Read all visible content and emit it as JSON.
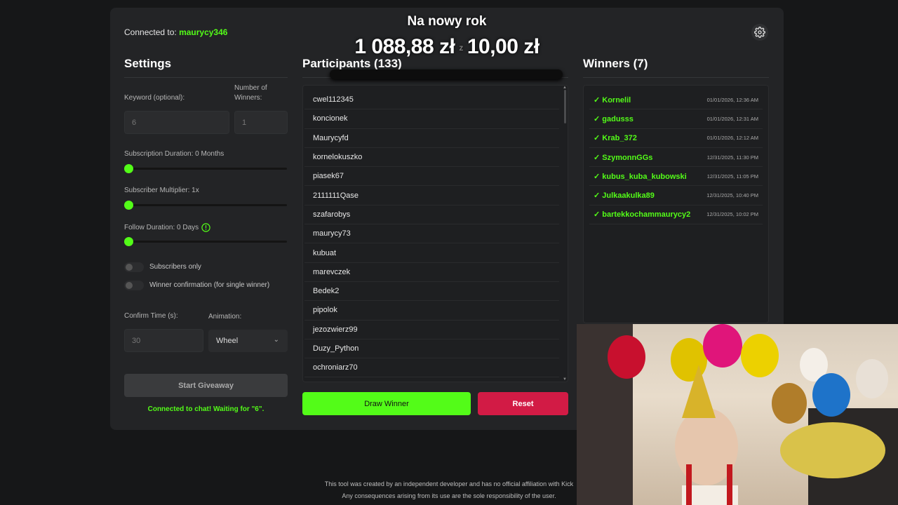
{
  "header": {
    "connected_label": "Connected to:",
    "channel": "maurycy346"
  },
  "overlay": {
    "title": "Na nowy rok",
    "current_amount": "1 088,88 zł",
    "separator": "z",
    "goal_amount": "10,00 zł"
  },
  "settings": {
    "title": "Settings",
    "keyword_label": "Keyword (optional):",
    "keyword_value": "6",
    "winners_label": "Number of Winners:",
    "winners_value": "1",
    "sub_duration_label": "Subscription Duration: 0 Months",
    "sub_multiplier_label": "Subscriber Multiplier: 1x",
    "follow_duration_label": "Follow Duration: 0 Days",
    "subscribers_only_label": "Subscribers only",
    "winner_confirmation_label": "Winner confirmation (for single winner)",
    "confirm_time_label": "Confirm Time (s):",
    "confirm_time_value": "30",
    "animation_label": "Animation:",
    "animation_value": "Wheel",
    "start_button": "Start Giveaway",
    "status": "Connected to chat! Waiting for \"6\"."
  },
  "participants": {
    "title": "Participants (133)",
    "items": [
      "cwel112345",
      "koncionek",
      "Maurycyfd",
      "kornelokuszko",
      "piasek67",
      "2111111Qase",
      "szafarobys",
      "maurycy73",
      "kubuat",
      "marevczek",
      "Bedek2",
      "pipolok",
      "jezozwierz99",
      "Duzy_Python",
      "ochroniarz70"
    ],
    "draw_button": "Draw Winner",
    "reset_button": "Reset"
  },
  "winners": {
    "title": "Winners (7)",
    "items": [
      {
        "name": "✓ Kornelil",
        "date": "01/01/2026, 12:36 AM"
      },
      {
        "name": "✓ gadusss",
        "date": "01/01/2026, 12:31 AM"
      },
      {
        "name": "✓ Krab_372",
        "date": "01/01/2026, 12:12 AM"
      },
      {
        "name": "✓ SzymonnGGs",
        "date": "12/31/2025, 11:30 PM"
      },
      {
        "name": "✓ kubus_kuba_kubowski",
        "date": "12/31/2025, 11:05 PM"
      },
      {
        "name": "✓ Julkaakulka89",
        "date": "12/31/2025, 10:40 PM"
      },
      {
        "name": "✓ bartekkochammaurycy2",
        "date": "12/31/2025, 10:02 PM"
      }
    ]
  },
  "footer": {
    "line1": "This tool was created by an independent developer and has no official affiliation with Kick",
    "line2": "Any consequences arising from its use are the sole responsibility of the user."
  },
  "colors": {
    "accent": "#53fc18",
    "reset": "#d21b45",
    "panel": "#232426",
    "background": "#161718"
  }
}
